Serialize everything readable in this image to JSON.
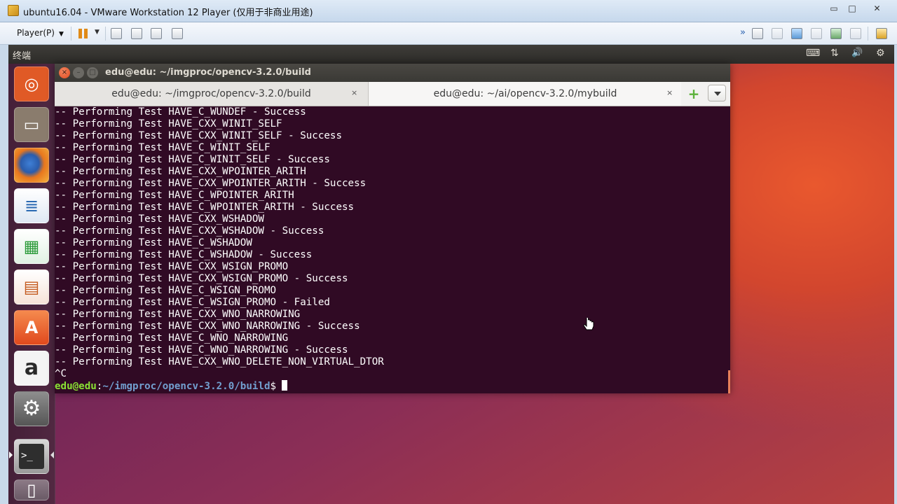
{
  "host": {
    "title": "ubuntu16.04 - VMware Workstation 12 Player (仅用于非商业用途)",
    "window_controls": {
      "minimize": "▭",
      "maximize": "□",
      "close": "✕"
    },
    "toolbar": {
      "player_menu": "Player(P)",
      "caret": "▼"
    }
  },
  "guest": {
    "topbar": {
      "app_name": "终端",
      "indicators": {
        "keyboard": "⌨",
        "network": "⇅",
        "volume": "🔊",
        "settings": "⚙"
      }
    },
    "launcher": {
      "items": [
        {
          "name": "dash-home",
          "glyph": "◎",
          "color": "#e05a26"
        },
        {
          "name": "files",
          "glyph": "▭",
          "color": "#8a7c6d"
        },
        {
          "name": "firefox",
          "glyph": "●",
          "color": "#e7761e"
        },
        {
          "name": "libreoffice-writer",
          "glyph": "≣",
          "color": "#2b6ab3"
        },
        {
          "name": "libreoffice-calc",
          "glyph": "▦",
          "color": "#2c9b3a"
        },
        {
          "name": "libreoffice-impress",
          "glyph": "▤",
          "color": "#c45a1f"
        },
        {
          "name": "ubuntu-software",
          "glyph": "A",
          "color": "#e65f2b"
        },
        {
          "name": "amazon",
          "glyph": "a",
          "color": "#2a2a2a"
        },
        {
          "name": "system-settings",
          "glyph": "⚙",
          "color": "#6a6a6a"
        },
        {
          "name": "terminal",
          "glyph": ">_",
          "color": "#2e2e2e"
        },
        {
          "name": "trash",
          "glyph": "▯",
          "color": "#7a6a74"
        }
      ]
    },
    "terminal": {
      "title": "edu@edu: ~/imgproc/opencv-3.2.0/build",
      "tabs": [
        {
          "label": "edu@edu: ~/imgproc/opencv-3.2.0/build",
          "close": "×"
        },
        {
          "label": "edu@edu: ~/ai/opencv-3.2.0/mybuild",
          "close": "×"
        }
      ],
      "add_tab": "+",
      "lines": [
        "-- Performing Test HAVE_C_WUNDEF - Success",
        "-- Performing Test HAVE_CXX_WINIT_SELF",
        "-- Performing Test HAVE_CXX_WINIT_SELF - Success",
        "-- Performing Test HAVE_C_WINIT_SELF",
        "-- Performing Test HAVE_C_WINIT_SELF - Success",
        "-- Performing Test HAVE_CXX_WPOINTER_ARITH",
        "-- Performing Test HAVE_CXX_WPOINTER_ARITH - Success",
        "-- Performing Test HAVE_C_WPOINTER_ARITH",
        "-- Performing Test HAVE_C_WPOINTER_ARITH - Success",
        "-- Performing Test HAVE_CXX_WSHADOW",
        "-- Performing Test HAVE_CXX_WSHADOW - Success",
        "-- Performing Test HAVE_C_WSHADOW",
        "-- Performing Test HAVE_C_WSHADOW - Success",
        "-- Performing Test HAVE_CXX_WSIGN_PROMO",
        "-- Performing Test HAVE_CXX_WSIGN_PROMO - Success",
        "-- Performing Test HAVE_C_WSIGN_PROMO",
        "-- Performing Test HAVE_C_WSIGN_PROMO - Failed",
        "-- Performing Test HAVE_CXX_WNO_NARROWING",
        "-- Performing Test HAVE_CXX_WNO_NARROWING - Success",
        "-- Performing Test HAVE_C_WNO_NARROWING",
        "-- Performing Test HAVE_C_WNO_NARROWING - Success",
        "-- Performing Test HAVE_CXX_WNO_DELETE_NON_VIRTUAL_DTOR",
        "^C"
      ],
      "prompt": {
        "user": "edu@edu",
        "sep": ":",
        "path": "~/imgproc/opencv-3.2.0/build",
        "symbol": "$"
      }
    }
  }
}
